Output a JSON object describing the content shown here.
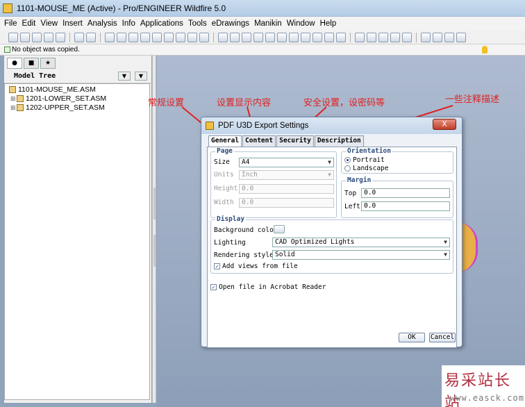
{
  "window": {
    "title": "1101-MOUSE_ME (Active) - Pro/ENGINEER Wildfire 5.0"
  },
  "menu": [
    "File",
    "Edit",
    "View",
    "Insert",
    "Analysis",
    "Info",
    "Applications",
    "Tools",
    "eDrawings",
    "Manikin",
    "Window",
    "Help"
  ],
  "message": "No object was copied.",
  "navigator": {
    "header": "Model Tree",
    "tree": {
      "root": "1101-MOUSE_ME.ASM",
      "children": [
        "1201-LOWER_SET.ASM",
        "1202-UPPER_SET.ASM"
      ]
    }
  },
  "annotations": {
    "general": "常规设置",
    "content": "设置显示内容",
    "security": "安全设置，设密码等",
    "description": "一些注释描述"
  },
  "dialog": {
    "title": "PDF U3D Export Settings",
    "close_label": "X",
    "tabs": [
      "General",
      "Content",
      "Security",
      "Description"
    ],
    "page": {
      "group_title": "Page",
      "size_label": "Size",
      "size_value": "A4",
      "units_label": "Units",
      "units_value": "Inch",
      "height_label": "Height",
      "height_value": "0.0",
      "width_label": "Width",
      "width_value": "0.0"
    },
    "orientation": {
      "group_title": "Orientation",
      "portrait": "Portrait",
      "landscape": "Landscape",
      "selected": "Portrait"
    },
    "margin": {
      "group_title": "Margin",
      "top_label": "Top",
      "top_value": "0.0",
      "left_label": "Left",
      "left_value": "0.0"
    },
    "display": {
      "group_title": "Display",
      "background_label": "Background color",
      "lighting_label": "Lighting",
      "lighting_value": "CAD Optimized Lights",
      "rendering_label": "Rendering style",
      "rendering_value": "Solid",
      "add_views_label": "Add views from file",
      "add_views_checked": true
    },
    "open_acrobat_label": "Open file in Acrobat Reader",
    "open_acrobat_checked": true,
    "ok_label": "OK",
    "cancel_label": "Cancel"
  },
  "watermark": {
    "main": "易采站长站",
    "url": "www.easck.com"
  },
  "colors": {
    "annotation": "#e02020",
    "graphics_bg": "#9fb0c6",
    "part": "#e8b048"
  }
}
